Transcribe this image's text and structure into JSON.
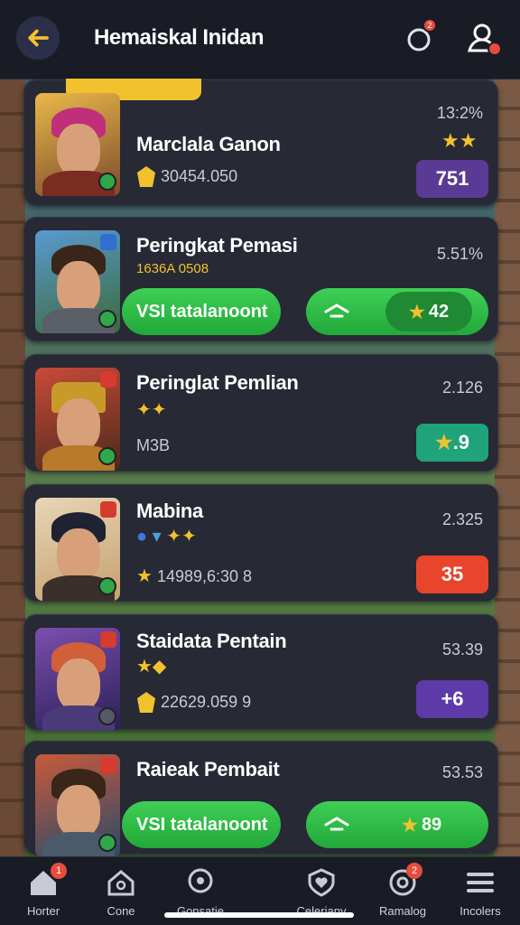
{
  "header": {
    "title": "Hemaiskal Inidan",
    "notify_badge": "2"
  },
  "cards": [
    {
      "name": "Marclala Ganon",
      "pct": "13:2%",
      "sub": "30454.050",
      "score": "751",
      "score_color": "#5b3a96"
    },
    {
      "name": "Peringkat Pemasi",
      "pct": "5.51%",
      "sub": "1636A 0508",
      "pill_label": "VSI tatalanoont",
      "pill_score": "42"
    },
    {
      "name": "Peringlat Pemlian",
      "pct": "2.126",
      "sub": "M3B",
      "score": ".9",
      "score_color": "#1fa37a"
    },
    {
      "name": "Mabina",
      "pct": "2.325",
      "sub": "14989,6:30 8",
      "score": "35",
      "score_color": "#e8452c"
    },
    {
      "name": "Staidata Pentain",
      "pct": "53.39",
      "sub": "22629.059 9",
      "score": "+6",
      "score_color": "#5d3aa8"
    },
    {
      "name": "Raieak Pembait",
      "pct": "53.53",
      "pill_label": "VSI tatalanoont",
      "pill_score": "89"
    }
  ],
  "nav": [
    {
      "label": "Horter",
      "icon": "home-icon",
      "badge": "1"
    },
    {
      "label": "Cone",
      "icon": "house-outline-icon"
    },
    {
      "label": "Gonsatie",
      "icon": "chat-icon"
    },
    {
      "label": "Celeriany",
      "icon": "shield-heart-icon"
    },
    {
      "label": "Ramalog",
      "icon": "target-icon",
      "badge": "2"
    },
    {
      "label": "Incolers",
      "icon": "menu-icon"
    }
  ]
}
